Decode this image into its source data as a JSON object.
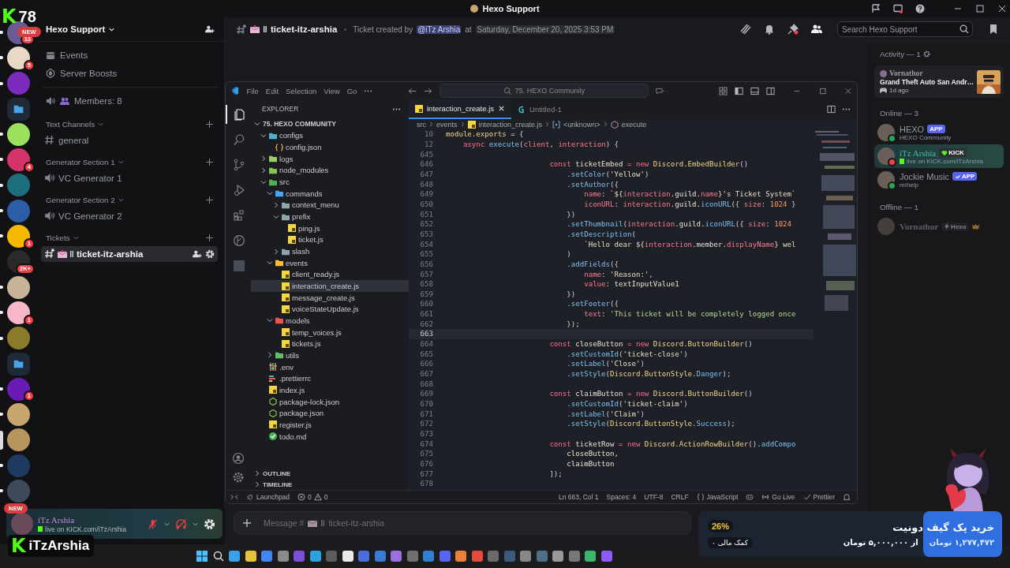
{
  "window": {
    "title": "Hexo Support"
  },
  "overlay": {
    "logo": "K",
    "viewers": "78",
    "top_badge": "NEW",
    "bottom_badge": "NEW",
    "badge_logo": "K",
    "streamer": "iTzArshia"
  },
  "servers": [
    {
      "kind": "server",
      "color": "#6b5b95",
      "badge": "13",
      "unread": true,
      "selected": false
    },
    {
      "kind": "server",
      "color": "#e8d8c8",
      "badge": "5",
      "unread": true,
      "selected": false
    },
    {
      "kind": "server",
      "color": "#7b2cbf",
      "unread": true,
      "selected": false
    },
    {
      "kind": "folder",
      "unread": false,
      "selected": false
    },
    {
      "kind": "server",
      "color": "#9be15d",
      "unread": true,
      "selected": false
    },
    {
      "kind": "server",
      "color": "#d6336c",
      "badge": "4",
      "unread": true,
      "selected": false
    },
    {
      "kind": "server",
      "color": "#1c6e7d",
      "unread": true,
      "selected": false
    },
    {
      "kind": "server",
      "color": "#2b5ea7",
      "unread": true,
      "selected": false
    },
    {
      "kind": "server",
      "color": "#f5b700",
      "badge": "1",
      "unread": true,
      "selected": false
    },
    {
      "kind": "server",
      "color": "#2a2a2a",
      "badge": "2K+",
      "unread": false,
      "selected": false
    },
    {
      "kind": "server",
      "color": "#c9b49a",
      "unread": true,
      "selected": false
    },
    {
      "kind": "server",
      "color": "#f7b7c8",
      "badge": "1",
      "unread": true,
      "selected": false
    },
    {
      "kind": "server",
      "color": "#8a7a2a",
      "unread": true,
      "selected": false
    },
    {
      "kind": "folder",
      "unread": false,
      "selected": false
    },
    {
      "kind": "server",
      "color": "#6a1bb5",
      "badge": "1",
      "unread": true,
      "selected": false
    },
    {
      "kind": "server",
      "color": "#c8a46e",
      "unread": true,
      "selected": false
    },
    {
      "kind": "server",
      "color": "#b8955e",
      "unread": false,
      "selected": true
    },
    {
      "kind": "server",
      "color": "#1e3a5f",
      "unread": true,
      "selected": false
    },
    {
      "kind": "server",
      "color": "#3c4a5a",
      "unread": true,
      "selected": false
    }
  ],
  "server_header": {
    "name": "Hexo Support"
  },
  "nav_items": [
    {
      "kind": "events",
      "label": "Events"
    },
    {
      "kind": "boosts",
      "label": "Server Boosts"
    }
  ],
  "members_channel": {
    "label": "Members: 8"
  },
  "categories": [
    {
      "name": "Text Channels",
      "channels": [
        {
          "kind": "text",
          "name": "general",
          "selected": false
        }
      ]
    },
    {
      "name": "Generator Section 1",
      "channels": [
        {
          "kind": "voice",
          "name": "VC Generator 1",
          "selected": false
        }
      ]
    },
    {
      "name": "Generator Section 2",
      "channels": [
        {
          "kind": "voice",
          "name": "VC Generator 2",
          "selected": false
        }
      ]
    },
    {
      "name": "Tickets",
      "channels": [
        {
          "kind": "ticket",
          "name": "ticket-itz-arshia",
          "selected": true
        }
      ]
    }
  ],
  "user_panel": {
    "name": "iTz Arshia",
    "status": "live on KICK.com/iTzArshia",
    "mic_muted": true,
    "deafened": true
  },
  "header": {
    "channel": "ticket-itz-arshia",
    "topic_prefix": "Ticket created by",
    "mention": "@iTz Arshia",
    "topic_joiner": "at",
    "timestamp": "Saturday, December 20, 2025 3:53 PM",
    "search_placeholder": "Search Hexo Support"
  },
  "message_bar": {
    "placeholder": "Message #",
    "channel": "ticket-itz-arshia"
  },
  "activity": {
    "heading": "Activity — 1",
    "user": "Vornathor",
    "game": "Grand Theft Auto San Andr…",
    "time": "1d ago"
  },
  "member_groups": [
    {
      "heading": "Online — 3",
      "members": [
        {
          "name": "HEXO",
          "tag": "APP",
          "kind": "app",
          "verified": false,
          "owner": false,
          "subtitle": "HEXO Community",
          "color": "#23a55a",
          "highlighted": false,
          "online": true
        },
        {
          "name": "iTz Arshia",
          "tag": "KICK",
          "kind": "kick",
          "verified": false,
          "owner": false,
          "subtitle": "live on KICK.com/iTzArshia",
          "color": "#f23f43",
          "highlighted": true,
          "online": true
        },
        {
          "name": "Jockie Music",
          "tag": "APP",
          "kind": "app",
          "verified": true,
          "owner": false,
          "subtitle": "m!help",
          "color": "#23a55a",
          "highlighted": false,
          "online": true
        }
      ]
    },
    {
      "heading": "Offline — 1",
      "members": [
        {
          "name": "Vornathor",
          "tag": "Hexo",
          "kind": "guild",
          "verified": false,
          "owner": true,
          "highlighted": false,
          "online": false
        }
      ]
    }
  ],
  "vscode": {
    "menu": [
      "File",
      "Edit",
      "Selection",
      "View",
      "Go"
    ],
    "command_center": "75. HEXO Community",
    "activity_bar": [
      {
        "kind": "explorer",
        "selected": true
      },
      {
        "kind": "search",
        "selected": false
      },
      {
        "kind": "source-control",
        "selected": false
      },
      {
        "kind": "run",
        "selected": false
      },
      {
        "kind": "extensions",
        "selected": false
      },
      {
        "kind": "git",
        "selected": false
      },
      {
        "kind": "env",
        "selected": false
      }
    ],
    "explorer_title": "EXPLORER",
    "root": "75. HEXO COMMUNITY",
    "tree": [
      {
        "name": "configs",
        "kind": "folder",
        "color": "#4fb3c8",
        "expanded": true,
        "selected": false,
        "children": [
          {
            "name": "config.json",
            "kind": "json",
            "selected": false
          }
        ]
      },
      {
        "name": "logs",
        "kind": "folder",
        "color": "#9ccc65",
        "expanded": false,
        "selected": false
      },
      {
        "name": "node_modules",
        "kind": "folder",
        "color": "#8bc34a",
        "expanded": false,
        "selected": false
      },
      {
        "name": "src",
        "kind": "folder",
        "color": "#4caf50",
        "expanded": true,
        "selected": false,
        "children": [
          {
            "name": "commands",
            "kind": "folder",
            "color": "#42a5f5",
            "expanded": true,
            "selected": false,
            "children": [
              {
                "name": "context_menu",
                "kind": "folder",
                "color": "#90a4ae",
                "expanded": false,
                "selected": false
              },
              {
                "name": "prefix",
                "kind": "folder",
                "color": "#90a4ae",
                "expanded": true,
                "selected": false,
                "children": [
                  {
                    "name": "ping.js",
                    "kind": "js",
                    "selected": false
                  },
                  {
                    "name": "ticket.js",
                    "kind": "js",
                    "selected": false
                  }
                ]
              },
              {
                "name": "slash",
                "kind": "folder",
                "color": "#90a4ae",
                "expanded": false,
                "selected": false
              }
            ]
          },
          {
            "name": "events",
            "kind": "folder",
            "color": "#fbc02d",
            "expanded": true,
            "selected": false,
            "children": [
              {
                "name": "client_ready.js",
                "kind": "js",
                "selected": false
              },
              {
                "name": "interaction_create.js",
                "kind": "js",
                "selected": true
              },
              {
                "name": "message_create.js",
                "kind": "js",
                "selected": false
              },
              {
                "name": "voiceStateUpdate.js",
                "kind": "js",
                "selected": false
              }
            ]
          },
          {
            "name": "models",
            "kind": "folder",
            "color": "#ef5350",
            "expanded": true,
            "selected": false,
            "children": [
              {
                "name": "temp_voices.js",
                "kind": "js",
                "selected": false
              },
              {
                "name": "tickets.js",
                "kind": "js",
                "selected": false
              }
            ]
          },
          {
            "name": "utils",
            "kind": "folder",
            "color": "#66bb6a",
            "expanded": false,
            "selected": false
          }
        ]
      },
      {
        "name": ".env",
        "kind": "env",
        "selected": false
      },
      {
        "name": ".prettierrc",
        "kind": "prettier",
        "selected": false
      },
      {
        "name": "index.js",
        "kind": "js",
        "selected": false
      },
      {
        "name": "package-lock.json",
        "kind": "npm",
        "selected": false
      },
      {
        "name": "package.json",
        "kind": "npm",
        "selected": false
      },
      {
        "name": "register.js",
        "kind": "js",
        "selected": false
      },
      {
        "name": "todo.md",
        "kind": "md",
        "selected": false
      }
    ],
    "sections": [
      "OUTLINE",
      "TIMELINE"
    ],
    "tabs": [
      {
        "label": "interaction_create.js",
        "kind": "js",
        "selected": true
      },
      {
        "label": "Untitled-1",
        "kind": "chat",
        "selected": false
      }
    ],
    "breadcrumb": [
      {
        "label": "src",
        "kind": "plain"
      },
      {
        "label": "events",
        "kind": "plain"
      },
      {
        "label": "interaction_create.js",
        "kind": "js"
      },
      {
        "label": "<unknown>",
        "kind": "module"
      },
      {
        "label": "execute",
        "kind": "method"
      }
    ],
    "lines": [
      {
        "n": "10",
        "current": false,
        "code": [
          {
            "t": "module.exports",
            "kind": "cls"
          },
          {
            "t": " = {",
            "kind": "pn"
          }
        ]
      },
      {
        "n": "12",
        "current": false,
        "code": [
          {
            "t": "    async",
            "kind": "kw"
          },
          {
            "t": " execute",
            "kind": "fn"
          },
          {
            "t": "(",
            "kind": "pn"
          },
          {
            "t": "client",
            "kind": "prm"
          },
          {
            "t": ", ",
            "kind": "pn"
          },
          {
            "t": "interaction",
            "kind": "prm"
          },
          {
            "t": ") {",
            "kind": "pn"
          }
        ]
      },
      {
        "n": "645",
        "current": false
      },
      {
        "n": "646",
        "current": false,
        "code": [
          {
            "t": "                        const",
            "kind": "kw"
          },
          {
            "t": " ticketEmbed ",
            "kind": "id"
          },
          {
            "t": "= new",
            "kind": "kw"
          },
          {
            "t": " Discord.EmbedBuilder",
            "kind": "cls"
          },
          {
            "t": "()",
            "kind": "pn"
          }
        ]
      },
      {
        "n": "647",
        "current": false,
        "code": [
          {
            "t": "                            .setColor",
            "kind": "fn"
          },
          {
            "t": "(",
            "kind": "pn"
          },
          {
            "t": "'Yellow'",
            "kind": "str"
          },
          {
            "t": ")",
            "kind": "pn"
          }
        ]
      },
      {
        "n": "648",
        "current": false,
        "code": [
          {
            "t": "                            .setAuthor",
            "kind": "fn"
          },
          {
            "t": "({",
            "kind": "pn"
          }
        ]
      },
      {
        "n": "649",
        "current": false,
        "code": [
          {
            "t": "                                name",
            "kind": "prm"
          },
          {
            "t": ": ",
            "kind": "pn"
          },
          {
            "t": "`${",
            "kind": "str"
          },
          {
            "t": "interaction",
            "kind": "prm"
          },
          {
            "t": ".guild.",
            "kind": "id"
          },
          {
            "t": "name",
            "kind": "prm"
          },
          {
            "t": "}'s Ticket System`",
            "kind": "str"
          }
        ]
      },
      {
        "n": "650",
        "current": false,
        "code": [
          {
            "t": "                                iconURL",
            "kind": "prm"
          },
          {
            "t": ": ",
            "kind": "pn"
          },
          {
            "t": "interaction",
            "kind": "prm"
          },
          {
            "t": ".guild.",
            "kind": "id"
          },
          {
            "t": "iconURL",
            "kind": "fn"
          },
          {
            "t": "({ ",
            "kind": "pn"
          },
          {
            "t": "size",
            "kind": "prm"
          },
          {
            "t": ": ",
            "kind": "pn"
          },
          {
            "t": "1024",
            "kind": "num"
          },
          {
            "t": " }",
            "kind": "pn"
          }
        ]
      },
      {
        "n": "651",
        "current": false,
        "code": [
          {
            "t": "                            })",
            "kind": "pn"
          }
        ]
      },
      {
        "n": "652",
        "current": false,
        "code": [
          {
            "t": "                            .setThumbnail",
            "kind": "fn"
          },
          {
            "t": "(",
            "kind": "pn"
          },
          {
            "t": "interaction",
            "kind": "prm"
          },
          {
            "t": ".guild.",
            "kind": "id"
          },
          {
            "t": "iconURL",
            "kind": "fn"
          },
          {
            "t": "({ ",
            "kind": "pn"
          },
          {
            "t": "size",
            "kind": "prm"
          },
          {
            "t": ": ",
            "kind": "pn"
          },
          {
            "t": "1024",
            "kind": "num"
          }
        ]
      },
      {
        "n": "653",
        "current": false,
        "code": [
          {
            "t": "                            .setDescription",
            "kind": "fn"
          },
          {
            "t": "(",
            "kind": "pn"
          }
        ]
      },
      {
        "n": "654",
        "current": false,
        "code": [
          {
            "t": "                                `Hello dear ${",
            "kind": "str"
          },
          {
            "t": "interaction",
            "kind": "prm"
          },
          {
            "t": ".member.",
            "kind": "id"
          },
          {
            "t": "displayName",
            "kind": "prm"
          },
          {
            "t": "} wel",
            "kind": "str"
          }
        ]
      },
      {
        "n": "655",
        "current": false,
        "code": [
          {
            "t": "                            )",
            "kind": "pn"
          }
        ]
      },
      {
        "n": "656",
        "current": false,
        "code": [
          {
            "t": "                            .addFields",
            "kind": "fn"
          },
          {
            "t": "({",
            "kind": "pn"
          }
        ]
      },
      {
        "n": "657",
        "current": false,
        "code": [
          {
            "t": "                                name",
            "kind": "prm"
          },
          {
            "t": ": ",
            "kind": "pn"
          },
          {
            "t": "'Reason:'",
            "kind": "str"
          },
          {
            "t": ",",
            "kind": "pn"
          }
        ]
      },
      {
        "n": "658",
        "current": false,
        "code": [
          {
            "t": "                                value",
            "kind": "prm"
          },
          {
            "t": ": ",
            "kind": "pn"
          },
          {
            "t": "textInputValue1",
            "kind": "id"
          }
        ]
      },
      {
        "n": "659",
        "current": false,
        "code": [
          {
            "t": "                            })",
            "kind": "pn"
          }
        ]
      },
      {
        "n": "660",
        "current": false,
        "code": [
          {
            "t": "                            .setFooter",
            "kind": "fn"
          },
          {
            "t": "({",
            "kind": "pn"
          }
        ]
      },
      {
        "n": "661",
        "current": false,
        "code": [
          {
            "t": "                                text",
            "kind": "prm"
          },
          {
            "t": ": ",
            "kind": "pn"
          },
          {
            "t": "'This ticket will be completely logged once",
            "kind": "tstr"
          }
        ]
      },
      {
        "n": "662",
        "current": false,
        "code": [
          {
            "t": "                            });",
            "kind": "pn"
          }
        ]
      },
      {
        "n": "663",
        "current": true
      },
      {
        "n": "664",
        "current": false,
        "code": [
          {
            "t": "                        const",
            "kind": "kw"
          },
          {
            "t": " closeButton ",
            "kind": "id"
          },
          {
            "t": "= new",
            "kind": "kw"
          },
          {
            "t": " Discord.ButtonBuilder",
            "kind": "cls"
          },
          {
            "t": "()",
            "kind": "pn"
          }
        ]
      },
      {
        "n": "665",
        "current": false,
        "code": [
          {
            "t": "                            .setCustomId",
            "kind": "fn"
          },
          {
            "t": "(",
            "kind": "pn"
          },
          {
            "t": "'ticket-close'",
            "kind": "str"
          },
          {
            "t": ")",
            "kind": "pn"
          }
        ]
      },
      {
        "n": "666",
        "current": false,
        "code": [
          {
            "t": "                            .setLabel",
            "kind": "fn"
          },
          {
            "t": "(",
            "kind": "pn"
          },
          {
            "t": "'Close'",
            "kind": "str"
          },
          {
            "t": ")",
            "kind": "pn"
          }
        ]
      },
      {
        "n": "667",
        "current": false,
        "code": [
          {
            "t": "                            .setStyle",
            "kind": "fn"
          },
          {
            "t": "(",
            "kind": "pn"
          },
          {
            "t": "Discord.ButtonStyle.",
            "kind": "cls"
          },
          {
            "t": "Danger",
            "kind": "fn"
          },
          {
            "t": ");",
            "kind": "pn"
          }
        ]
      },
      {
        "n": "668",
        "current": false
      },
      {
        "n": "669",
        "current": false,
        "code": [
          {
            "t": "                        const",
            "kind": "kw"
          },
          {
            "t": " claimButton ",
            "kind": "id"
          },
          {
            "t": "= new",
            "kind": "kw"
          },
          {
            "t": " Discord.ButtonBuilder",
            "kind": "cls"
          },
          {
            "t": "()",
            "kind": "pn"
          }
        ]
      },
      {
        "n": "670",
        "current": false,
        "code": [
          {
            "t": "                            .setCustomId",
            "kind": "fn"
          },
          {
            "t": "(",
            "kind": "pn"
          },
          {
            "t": "'ticket-claim'",
            "kind": "str"
          },
          {
            "t": ")",
            "kind": "pn"
          }
        ]
      },
      {
        "n": "671",
        "current": false,
        "code": [
          {
            "t": "                            .setLabel",
            "kind": "fn"
          },
          {
            "t": "(",
            "kind": "pn"
          },
          {
            "t": "'Claim'",
            "kind": "str"
          },
          {
            "t": ")",
            "kind": "pn"
          }
        ]
      },
      {
        "n": "672",
        "current": false,
        "code": [
          {
            "t": "                            .setStyle",
            "kind": "fn"
          },
          {
            "t": "(",
            "kind": "pn"
          },
          {
            "t": "Discord.ButtonStyle.",
            "kind": "cls"
          },
          {
            "t": "Success",
            "kind": "fn"
          },
          {
            "t": ");",
            "kind": "pn"
          }
        ]
      },
      {
        "n": "673",
        "current": false
      },
      {
        "n": "674",
        "current": false,
        "code": [
          {
            "t": "                        const",
            "kind": "kw"
          },
          {
            "t": " ticketRow ",
            "kind": "id"
          },
          {
            "t": "= new",
            "kind": "kw"
          },
          {
            "t": " Discord.ActionRowBuilder",
            "kind": "cls"
          },
          {
            "t": "().",
            "kind": "pn"
          },
          {
            "t": "addCompo",
            "kind": "fn"
          }
        ]
      },
      {
        "n": "675",
        "current": false,
        "code": [
          {
            "t": "                            closeButton,",
            "kind": "id"
          }
        ]
      },
      {
        "n": "676",
        "current": false,
        "code": [
          {
            "t": "                            claimButton",
            "kind": "id"
          }
        ]
      },
      {
        "n": "677",
        "current": false,
        "code": [
          {
            "t": "                        ]);",
            "kind": "pn"
          }
        ]
      },
      {
        "n": "678",
        "current": false
      }
    ],
    "status_left": {
      "launchpad": "Launchpad",
      "errors": "0",
      "warnings": "0"
    },
    "status_right": [
      {
        "kind": "text",
        "label": "Ln 663, Col 1"
      },
      {
        "kind": "text",
        "label": "Spaces: 4"
      },
      {
        "kind": "text",
        "label": "UTF-8"
      },
      {
        "kind": "text",
        "label": "CRLF"
      },
      {
        "kind": "lang",
        "label": "JavaScript"
      },
      {
        "kind": "copilot"
      },
      {
        "kind": "golive",
        "label": "Go Live"
      },
      {
        "kind": "prettier",
        "label": "Prettier"
      },
      {
        "kind": "bell"
      }
    ]
  },
  "taskbar": [
    {
      "kind": "start"
    },
    {
      "kind": "search"
    },
    {
      "kind": "app",
      "color": "#3aa0e8"
    },
    {
      "kind": "app",
      "color": "#e8c23a"
    },
    {
      "kind": "app",
      "color": "#4285f4"
    },
    {
      "kind": "app",
      "color": "#8a8a8a"
    },
    {
      "kind": "app",
      "color": "#7b4fd6"
    },
    {
      "kind": "app",
      "color": "#2aa3df"
    },
    {
      "kind": "app",
      "color": "#5b5b5b"
    },
    {
      "kind": "app",
      "color": "#e8e8e8"
    },
    {
      "kind": "app",
      "color": "#4a6fdc"
    },
    {
      "kind": "app",
      "color": "#3a7bd5"
    },
    {
      "kind": "app",
      "color": "#9b6fe0"
    },
    {
      "kind": "app",
      "color": "#707070"
    },
    {
      "kind": "app",
      "color": "#2f80d0"
    },
    {
      "kind": "app",
      "color": "#5865f2"
    },
    {
      "kind": "app",
      "color": "#e8803a"
    },
    {
      "kind": "app",
      "color": "#e64a3a"
    },
    {
      "kind": "app",
      "color": "#6a6a6a"
    },
    {
      "kind": "app",
      "color": "#3c5a80"
    },
    {
      "kind": "app",
      "color": "#888888"
    },
    {
      "kind": "app",
      "color": "#4f6e8a"
    },
    {
      "kind": "app",
      "color": "#999999"
    },
    {
      "kind": "app",
      "color": "#777777"
    },
    {
      "kind": "app",
      "color": "#3bb56b"
    },
    {
      "kind": "app",
      "color": "#8b5cf6"
    }
  ],
  "donation": {
    "percent": "26%",
    "level": 0.26,
    "supporters": "۰ کمک مالی",
    "title": "خرید پک گیف دونیت",
    "raised": "۱,۲۷۷,۴۷۲ تومان",
    "goal": "از ۵,۰۰۰,۰۰۰ تومان"
  }
}
